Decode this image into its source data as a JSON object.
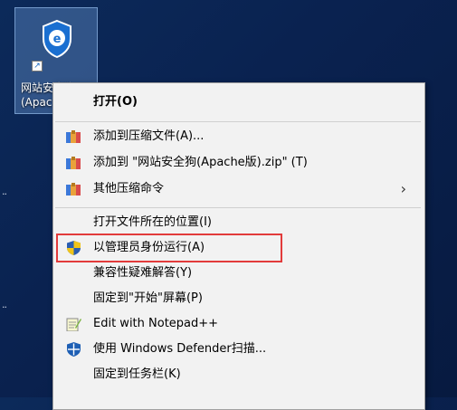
{
  "desktop": {
    "icon_label_line1": "网站安全狗",
    "icon_label_line2": "(Apac"
  },
  "menu": {
    "items": [
      {
        "label": "打开(O)",
        "icon": "none",
        "bold": true
      },
      {
        "label": "添加到压缩文件(A)...",
        "icon": "archive-icon"
      },
      {
        "label": "添加到 \"网站安全狗(Apache版).zip\" (T)",
        "icon": "archive-icon"
      },
      {
        "label": "其他压缩命令",
        "icon": "archive-icon",
        "submenu": true
      },
      {
        "label": "打开文件所在的位置(I)",
        "icon": "none"
      },
      {
        "label": "以管理员身份运行(A)",
        "icon": "uac-shield-icon"
      },
      {
        "label": "兼容性疑难解答(Y)",
        "icon": "none"
      },
      {
        "label": "固定到\"开始\"屏幕(P)",
        "icon": "none"
      },
      {
        "label": "Edit with Notepad++",
        "icon": "notepad-icon"
      },
      {
        "label": "使用 Windows Defender扫描...",
        "icon": "defender-icon"
      },
      {
        "label": "固定到任务栏(K)",
        "icon": "none"
      }
    ]
  },
  "colors": {
    "highlight_border": "#e23b3b",
    "menu_bg": "#f2f2f2"
  }
}
